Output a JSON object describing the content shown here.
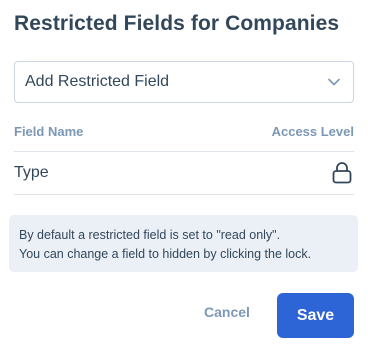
{
  "dialog": {
    "title": "Restricted Fields for Companies"
  },
  "select": {
    "value": "Add Restricted Field",
    "icon": "chevron-down-icon"
  },
  "table": {
    "headers": {
      "field_name": "Field Name",
      "access_level": "Access Level"
    },
    "rows": [
      {
        "name": "Type",
        "access_icon": "lock-icon"
      }
    ]
  },
  "info": {
    "line1": "By default a restricted field is set to \"read only\".",
    "line2": "You can change a field to hidden by clicking the lock."
  },
  "footer": {
    "cancel_label": "Cancel",
    "save_label": "Save"
  },
  "colors": {
    "primary": "#2d64d6",
    "text": "#33475b",
    "muted": "#7c98b6",
    "info_bg": "#eaf0f6",
    "border": "#cbd6e2"
  }
}
